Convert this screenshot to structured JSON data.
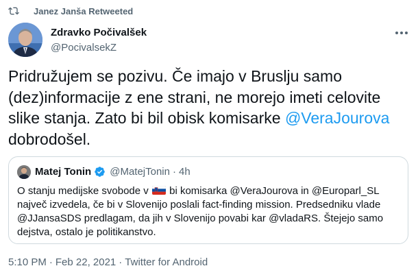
{
  "retweet": {
    "label": "Janez Janša Retweeted",
    "icon": "retweet-icon"
  },
  "author": {
    "name": "Zdravko Počivalšek",
    "handle": "@PocivalsekZ",
    "avatar_icon": "user-avatar"
  },
  "tweet": {
    "text_part1": "Pridružujem se pozivu. Če imajo v Bruslju samo (dez)informacije z ene strani, ne morejo imeti celovite slike stanja. Zato bi bil obisk komisarke ",
    "mention": "@VeraJourova",
    "text_part2": " dobrodošel."
  },
  "quote": {
    "name": "Matej Tonin",
    "handle": "@MatejTonin",
    "dot": "·",
    "time": "4h",
    "verified_icon": "verified-badge-icon",
    "text_a": "O stanju medijske svobode v ",
    "flag_icon": "slovenia-flag-icon",
    "text_b": " bi komisarka @VeraJourova in @Europarl_SL največ izvedela, če bi v Slovenijo poslali fact-finding mission. Predsedniku vlade @JJansaSDS predlagam, da jih v Slovenijo povabi kar @vladaRS. Štejejo samo dejstva, ostalo je politikanstvo."
  },
  "meta": {
    "time": "5:10 PM",
    "sep": "·",
    "date": "Feb 22, 2021",
    "sep2": "·",
    "source": "Twitter for Android"
  },
  "colors": {
    "accent": "#1d9bf0",
    "secondary_text": "#536471",
    "border": "#cfd9de"
  }
}
